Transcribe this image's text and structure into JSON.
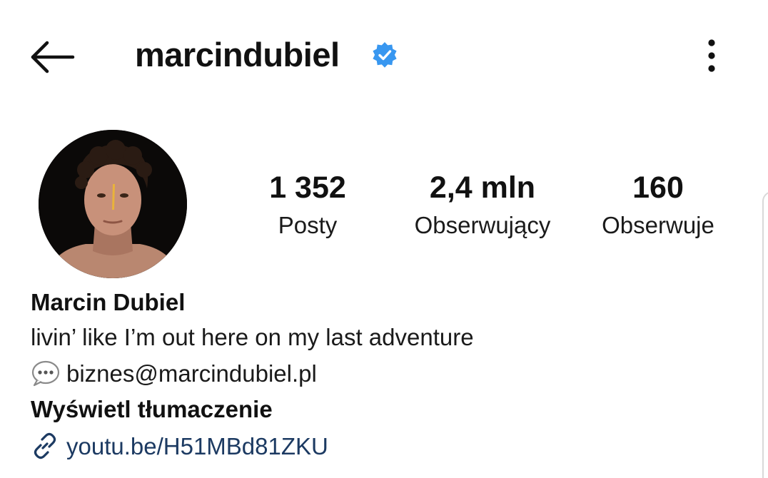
{
  "header": {
    "username": "marcindubiel",
    "verified": true,
    "back_icon": "arrow-left-icon",
    "more_icon": "more-vertical-icon",
    "verified_color": "#3897f0"
  },
  "profile": {
    "avatar_icon": "profile-photo"
  },
  "stats": {
    "posts_value": "1 352",
    "posts_label": "Posty",
    "followers_value": "2,4 mln",
    "followers_label": "Obserwujący",
    "following_value": "160",
    "following_label": "Obserwuje"
  },
  "bio": {
    "full_name": "Marcin Dubiel",
    "text": "livin’ like I’m out here on my last adventure",
    "contact_icon": "speech-bubble-icon",
    "contact_email": "biznes@marcindubiel.pl",
    "translate_label": "Wyświetl tłumaczenie",
    "link_icon": "link-icon",
    "link_text": "youtu.be/H51MBd81ZKU",
    "link_color": "#1c3a62"
  }
}
